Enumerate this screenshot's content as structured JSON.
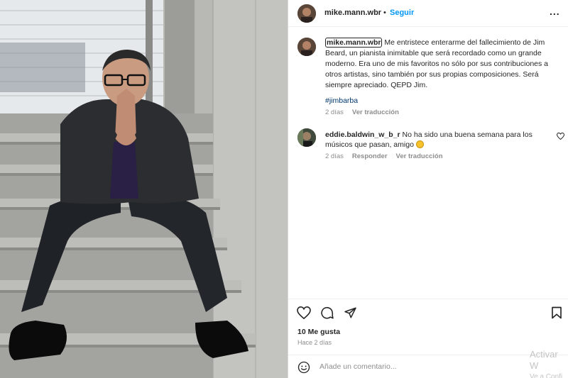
{
  "post": {
    "username": "mike.mann.wbr",
    "follow_label": "Seguir",
    "dot": "•",
    "more_label": "..."
  },
  "caption": {
    "username": "mike.mann.wbr",
    "text": " Me entristece enterarme del fallecimiento de Jim Beard, un pianista inimitable que será recordado como un grande moderno. Era uno de mis favoritos no sólo por sus contribuciones a otros artistas, sino también por sus propias composiciones. Será siempre apreciado. QEPD Jim.",
    "hashtag": "#jimbarba",
    "age": "2 días",
    "translate": "Ver traducción"
  },
  "comments": [
    {
      "username": "eddie.baldwin_w_b_r",
      "text": " No ha sido una buena semana para los músicos que pasan, amigo ",
      "emoji": "smiling-face-emoji",
      "age": "2 días",
      "reply": "Responder",
      "translate": "Ver traducción"
    }
  ],
  "stats": {
    "likes": "10 Me gusta",
    "date": "Hace 2 días"
  },
  "add_comment": {
    "placeholder": "Añade un comentario..."
  },
  "watermark": {
    "line1": "Activar W",
    "line2": "Ve a Confi"
  },
  "icons": {
    "like": "heart-icon",
    "comment": "comment-icon",
    "share": "send-icon",
    "save": "bookmark-icon",
    "emoji": "smile-icon"
  },
  "colors": {
    "link": "#0095f6",
    "hashtag": "#00376b",
    "muted": "#8e8e8e"
  }
}
